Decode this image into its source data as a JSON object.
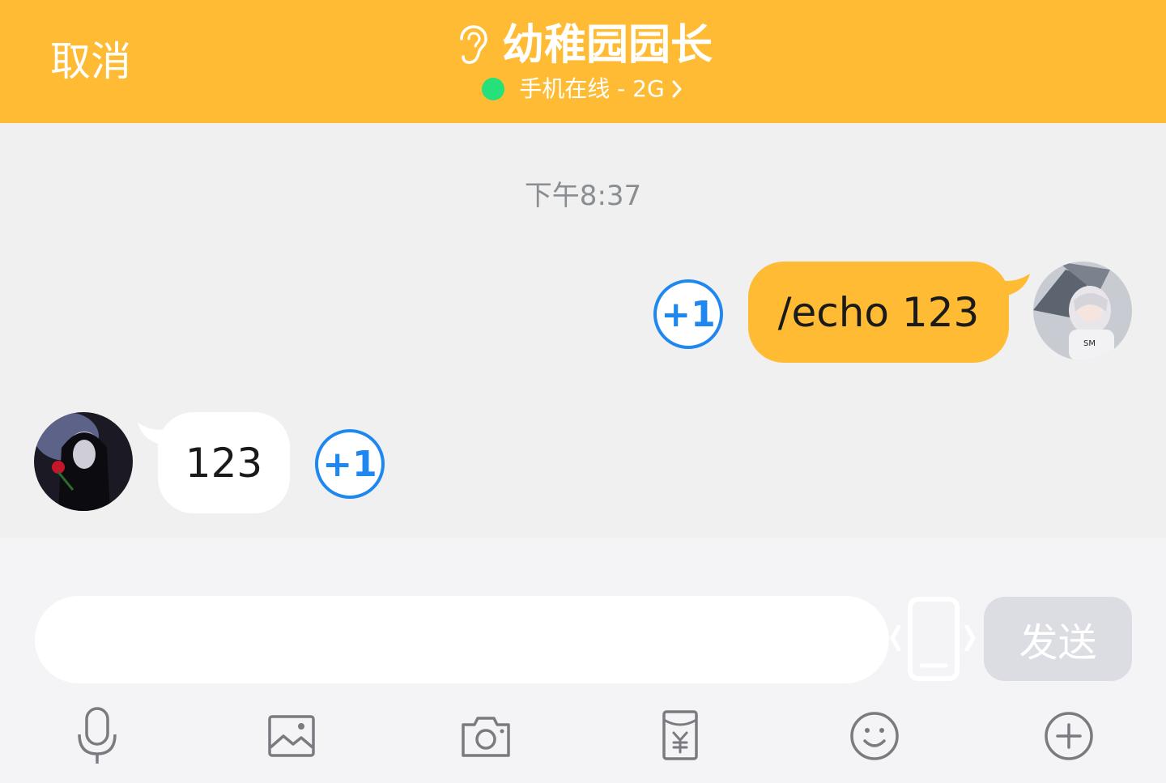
{
  "header": {
    "cancel_label": "取消",
    "title": "幼稚园园长",
    "status": "手机在线 - 2G",
    "bg_color": "#ffbb33",
    "online_color": "#26e07a"
  },
  "chat": {
    "timestamp": "下午8:37",
    "messages": [
      {
        "direction": "outgoing",
        "text": "/echo 123",
        "plus_one": "+1"
      },
      {
        "direction": "incoming",
        "text": "123",
        "plus_one": "+1"
      }
    ]
  },
  "composer": {
    "value": "",
    "send_label": "发送"
  },
  "toolbar": {
    "items": [
      "mic-icon",
      "image-icon",
      "camera-icon",
      "red-packet-icon",
      "emoji-icon",
      "plus-icon"
    ]
  }
}
